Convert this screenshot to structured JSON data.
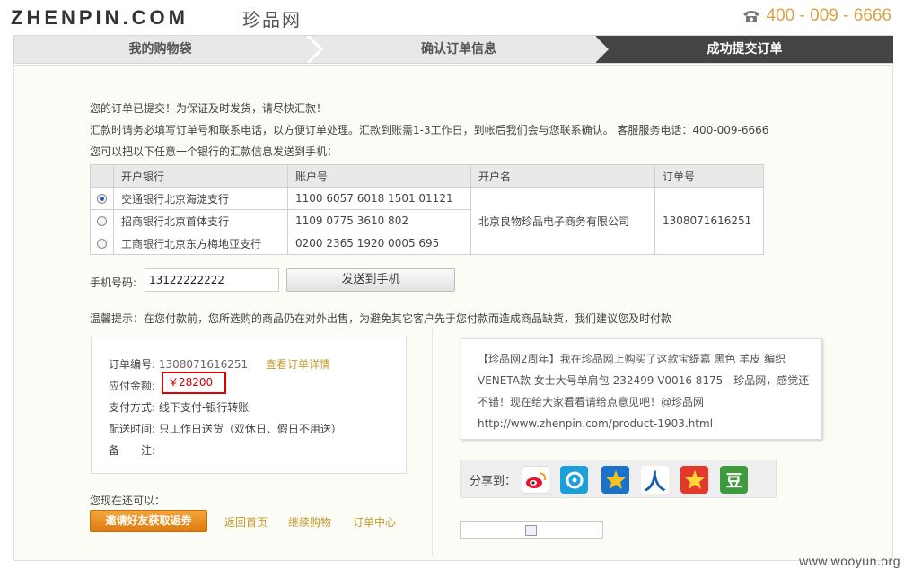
{
  "header": {
    "logo_text": "ZHENPIN.COM",
    "logo_cn": "珍品网",
    "hotline": "400 - 009 - 6666"
  },
  "steps": [
    {
      "label": "我的购物袋",
      "active": false
    },
    {
      "label": "确认订单信息",
      "active": false
    },
    {
      "label": "成功提交订单",
      "active": true
    }
  ],
  "notice": {
    "line1": "您的订单已提交！为保证及时发货，请尽快汇款！",
    "line2": "汇款时请务必填写订单号和联系电话，以方便订单处理。汇款到账需1-3工作日，到帐后我们会与您联系确认。 客服服务电话：400-009-6666",
    "line3": "您可以把以下任意一个银行的汇款信息发送到手机："
  },
  "bank_table": {
    "headers": [
      "开户银行",
      "账户号",
      "开户名",
      "订单号"
    ],
    "rows": [
      {
        "bank": "交通银行北京海淀支行",
        "account": "1100 6057 6018 1501 01121",
        "selected": true
      },
      {
        "bank": "招商银行北京首体支行",
        "account": "1109 0775 3610 802",
        "selected": false
      },
      {
        "bank": "工商银行北京东方梅地亚支行",
        "account": "0200 2365 1920 0005 695",
        "selected": false
      }
    ],
    "account_name": "北京良物珍品电子商务有限公司",
    "order_no": "1308071616251"
  },
  "phone": {
    "label": "手机号码:",
    "value": "13122222222",
    "send_label": "发送到手机"
  },
  "tip": "温馨提示：在您付款前，您所选购的商品仍在对外出售，为避免其它客户先于您付款而造成商品缺货，我们建议您及时付款",
  "order": {
    "no_label": "订单编号:",
    "no_value": "1308071616251",
    "view_link": "查看订单详情",
    "amount_label": "应付金额:",
    "amount_value": "￥28200",
    "pay_label": "支付方式:",
    "pay_value": "线下支付-银行转账",
    "delivery_label": "配送时间:",
    "delivery_value": "只工作日送货（双休日、假日不用送）",
    "remark_label": "备　　注:"
  },
  "share": {
    "text": "【珍品网2周年】我在珍品网上购买了这款宝缇嘉 黑色 羊皮 编织 VENETA款 女士大号单肩包 232499 V0016 8175 - 珍品网，感觉还不错！现在给大家看看请给点意见吧！@珍品网 http://www.zhenpin.com/product-1903.html",
    "label": "分享到：",
    "icons": [
      "weibo-icon",
      "tencent-weibo-icon",
      "qzone-icon",
      "renren-icon",
      "kaixin-icon",
      "douban-icon"
    ]
  },
  "actions": {
    "can_do": "您现在还可以：",
    "invite": "邀请好友获取返券",
    "links": [
      "返回首页",
      "继续购物",
      "订单中心"
    ]
  },
  "watermark": "www.wooyun.org",
  "colors": {
    "accent_gold": "#c29a2d",
    "hotline": "#d9a24a",
    "active_step": "#444444",
    "amount_red": "#cc0000",
    "invite_orange": "#e8891f"
  }
}
